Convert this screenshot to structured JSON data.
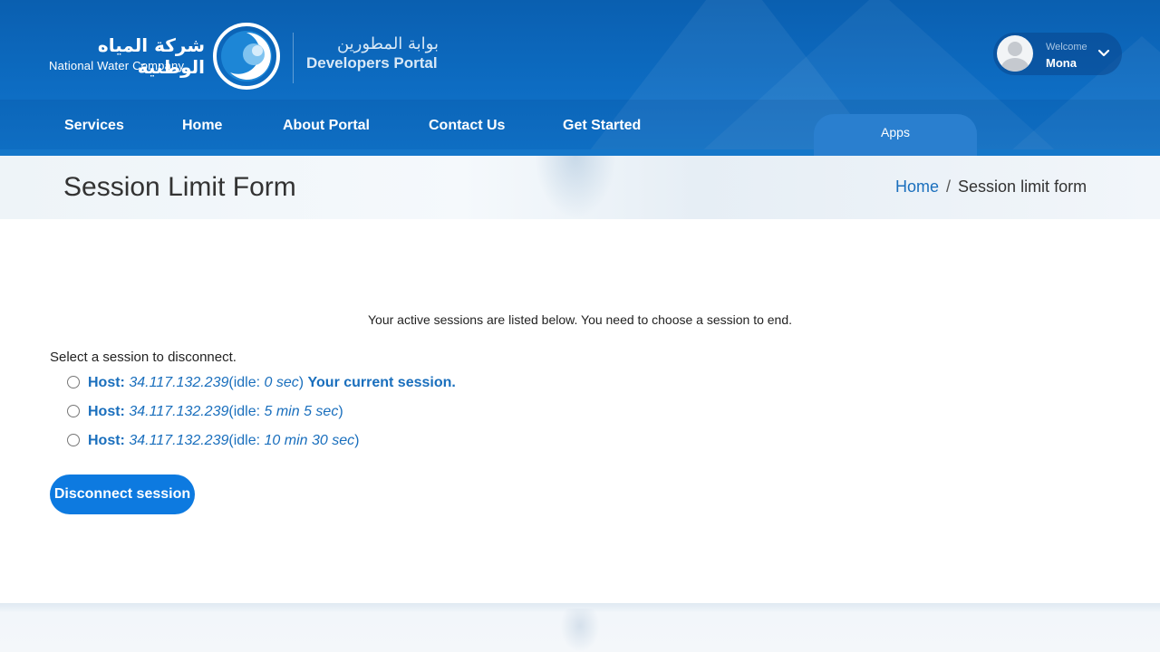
{
  "brand": {
    "name_ar": "شركة المياه الوطنية",
    "name_en": "National Water Company",
    "portal_ar": "بوابة المطورين",
    "portal_en": "Developers Portal"
  },
  "user": {
    "welcome": "Welcome",
    "name": "Mona"
  },
  "nav": {
    "items": [
      {
        "label": "Services"
      },
      {
        "label": "Home"
      },
      {
        "label": "About Portal"
      },
      {
        "label": "Contact Us"
      },
      {
        "label": "Get Started"
      }
    ],
    "apps_tab": "Apps"
  },
  "page": {
    "title": "Session Limit Form",
    "breadcrumb": {
      "home": "Home",
      "separator": "/",
      "current": "Session limit form"
    }
  },
  "form": {
    "intro": "Your active sessions are listed below. You need to choose a session to end.",
    "select_label": "Select a session to disconnect.",
    "host_label": "Host:",
    "sessions": [
      {
        "ip": "34.117.132.239",
        "idle_prefix": "(idle: ",
        "idle": "0 sec",
        "idle_suffix": ")",
        "note": "Your current session."
      },
      {
        "ip": "34.117.132.239",
        "idle_prefix": "(idle: ",
        "idle": "5 min 5 sec",
        "idle_suffix": ")",
        "note": ""
      },
      {
        "ip": "34.117.132.239",
        "idle_prefix": "(idle: ",
        "idle": "10 min 30 sec",
        "idle_suffix": ")",
        "note": ""
      }
    ],
    "submit_label": "Disconnect session"
  },
  "colors": {
    "header_blue": "#0d6cc2",
    "link_blue": "#1a6fbd",
    "button_blue": "#0d7ae0"
  }
}
